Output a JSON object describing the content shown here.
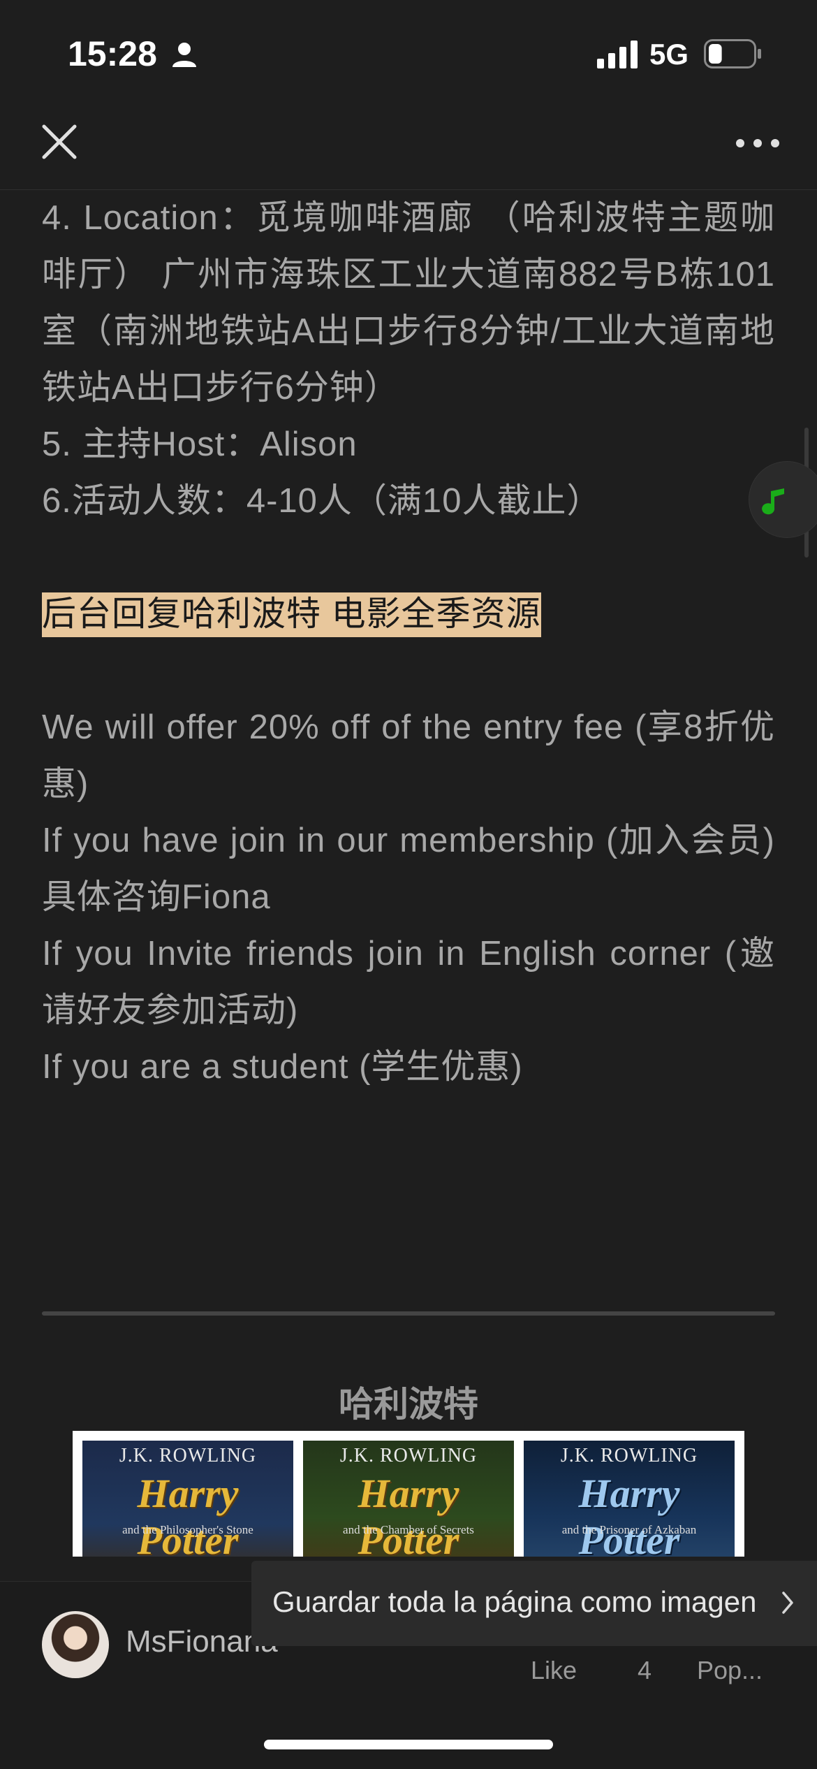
{
  "status_bar": {
    "time": "15:28",
    "network": "5G",
    "person_icon": "person-icon",
    "signal_icon": "signal-bars-icon",
    "battery_icon": "battery-icon",
    "battery_level": 0.3
  },
  "nav": {
    "close_icon": "close-icon",
    "more_icon": "more-dots-icon"
  },
  "article": {
    "lines_block_1": [
      "4. Location：觅境咖啡酒廊 （哈利波特主题咖啡厅） 广州市海珠区工业大道南882号B栋101室（南洲地铁站A出口步行8分钟/工业大道南地铁站A出口步行6分钟）",
      "5. 主持Host：Alison",
      "6.活动人数：4-10人（满10人截止）"
    ],
    "highlight": "后台回复哈利波特 电影全季资源",
    "promo_lines": [
      "We will offer 20% off of the entry fee (享8折优惠)",
      "If you have join in our membership (加入会员) 具体咨询Fiona",
      "If you Invite friends join in English corner (邀请好友参加活动)",
      "If you are a student (学生优惠)"
    ],
    "section_title": "哈利波特",
    "books": [
      {
        "author": "J.K. ROWLING",
        "title": "Harry Potter",
        "subtitle": "and the Philosopher's Stone"
      },
      {
        "author": "J.K. ROWLING",
        "title": "Harry Potter",
        "subtitle": "and the Chamber of Secrets"
      },
      {
        "author": "J.K. ROWLING",
        "title": "Harry Potter",
        "subtitle": "and the Prisoner of Azkaban"
      }
    ]
  },
  "floating": {
    "music_icon": "music-note-icon",
    "accent": "#1aad19"
  },
  "bottom": {
    "author_name": "MsFionana",
    "toast_text": "Guardar toda la página como imagen",
    "like_label": "Like",
    "like_count": "4",
    "pop_label": "Pop..."
  },
  "colors": {
    "background": "#1e1e1e",
    "text": "#a8a8a8",
    "highlight_bg": "#e8c79c"
  }
}
